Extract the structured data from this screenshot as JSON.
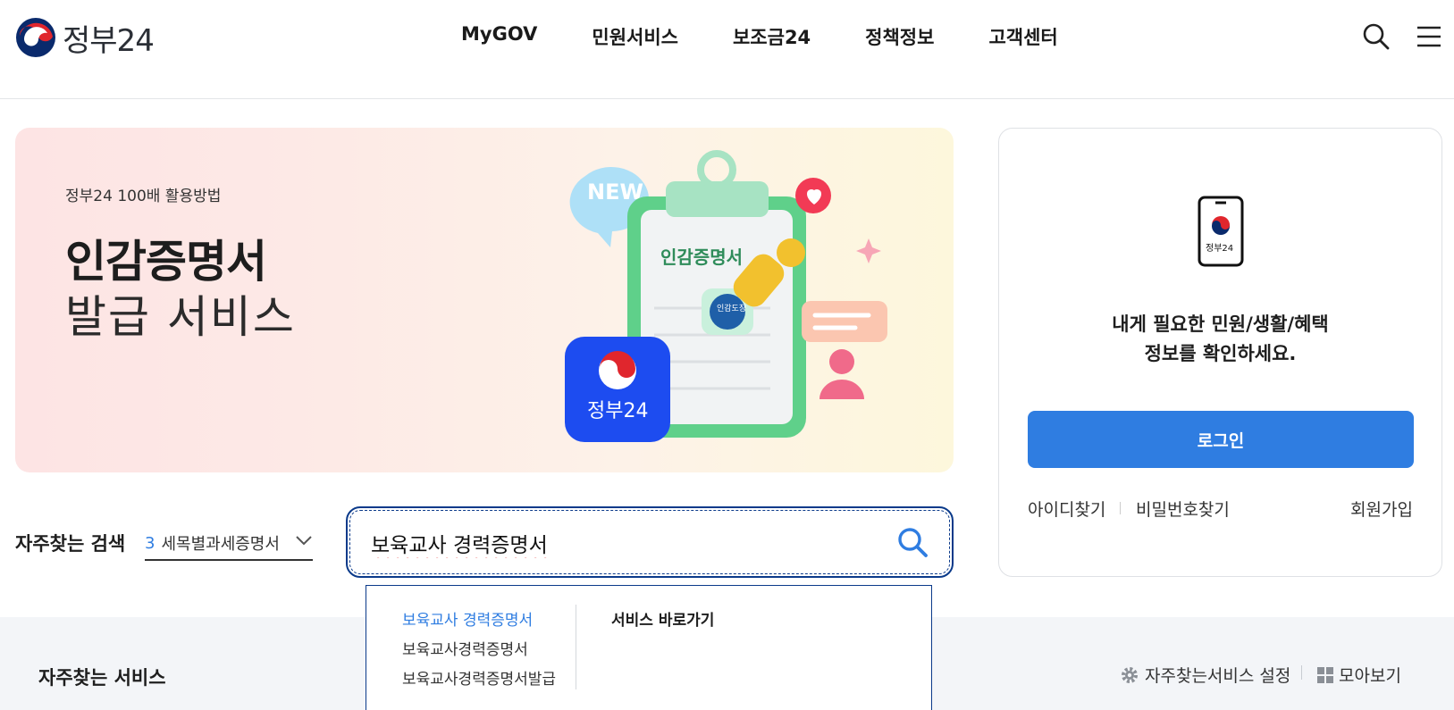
{
  "header": {
    "logo_text": "정부24",
    "nav": [
      "MyGOV",
      "민원서비스",
      "보조금24",
      "정책정보",
      "고객센터"
    ],
    "icons": [
      "search-icon",
      "menu-icon"
    ]
  },
  "banner": {
    "subtitle": "정부24 100배 활용방법",
    "title_line1": "인감증명서",
    "title_line2": "발급 서비스",
    "art_new": "NEW",
    "art_doc": "인감증명서",
    "art_seal": "인감도장",
    "art_app": "정부24"
  },
  "login_panel": {
    "phone_label": "정부24",
    "message_line1": "내게 필요한 민원/생활/혜택",
    "message_line2": "정보를 확인하세요.",
    "login_button": "로그인",
    "find_id": "아이디찾기",
    "find_password": "비밀번호찾기",
    "signup": "회원가입"
  },
  "search": {
    "frequent_label": "자주찾는 검색",
    "frequent_rank": "3",
    "frequent_term": "세목별과세증명서",
    "query": "보육교사 경력증명서"
  },
  "autocomplete": {
    "suggestions": [
      "보육교사 경력증명서",
      "보육교사경력증명서",
      "보육교사경력증명서발급"
    ],
    "shortcut_title": "서비스 바로가기"
  },
  "frequent_services": {
    "title": "자주찾는 서비스",
    "settings_link": "자주찾는서비스 설정",
    "view_all_link": "모아보기"
  },
  "colors": {
    "primary_blue": "#2f7de1",
    "focus_navy": "#0b3a8a",
    "section_grey": "#f3f5f8"
  }
}
